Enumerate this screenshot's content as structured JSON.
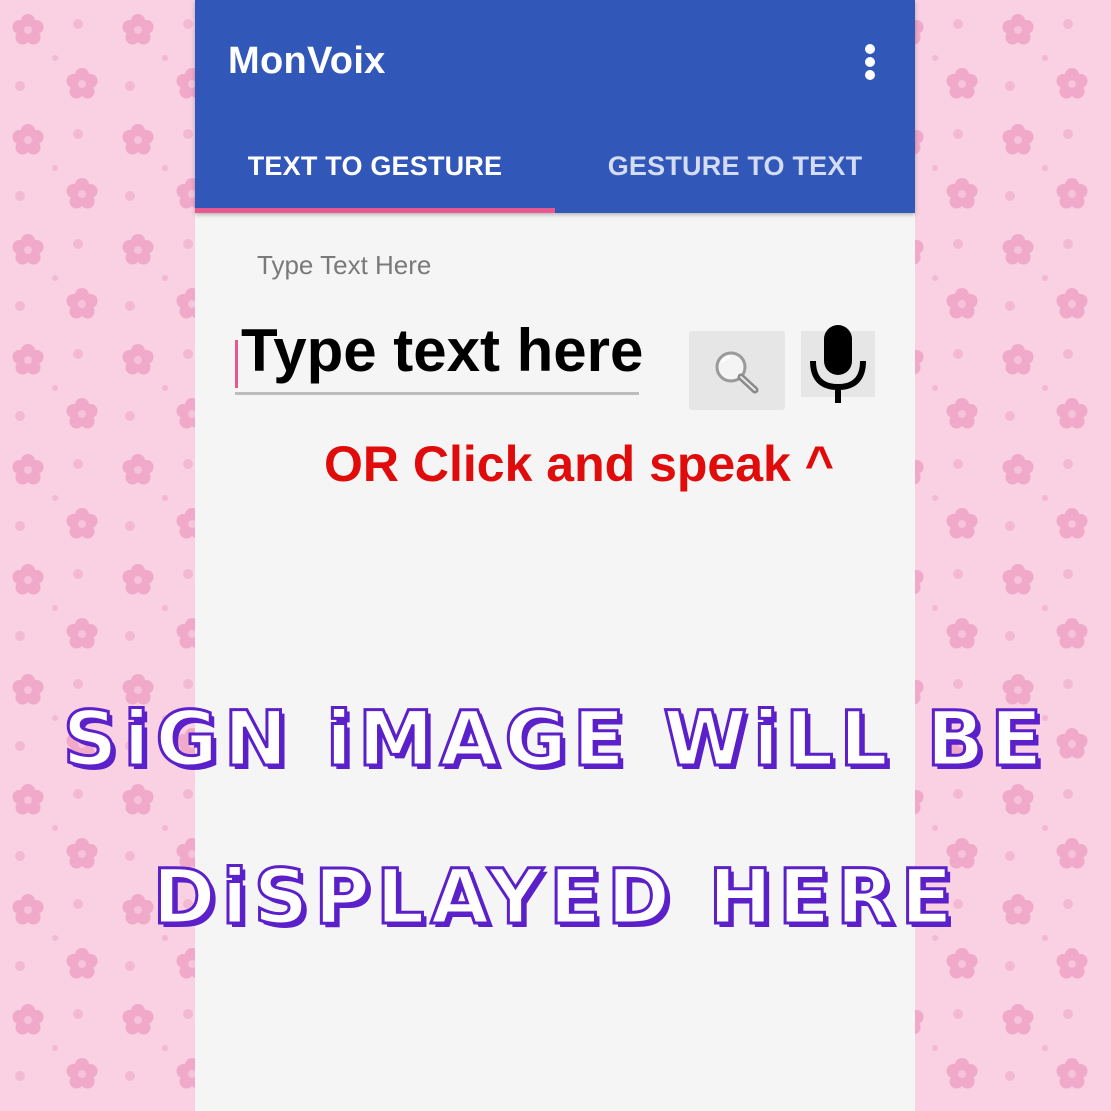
{
  "app": {
    "title": "MonVoix"
  },
  "tabs": [
    {
      "label": "TEXT TO GESTURE",
      "selected": true
    },
    {
      "label": "GESTURE TO TEXT",
      "selected": false
    }
  ],
  "input": {
    "hint": "Type Text Here",
    "value": "Type text here"
  },
  "speak_hint": "OR Click and speak ^",
  "sign_placeholder": {
    "line1": "SiGN iMAGE WiLL BE",
    "line2": "DiSPLAYED HERE"
  },
  "icons": {
    "search": "search-icon",
    "mic": "mic-icon",
    "menu": "more-vert-icon"
  },
  "colors": {
    "app_bar": "#3157b9",
    "tab_indicator": "#e9578f",
    "speak_hint": "#e00b0b",
    "placeholder_outline": "#5b20c9",
    "background": "#f9cfe1"
  }
}
